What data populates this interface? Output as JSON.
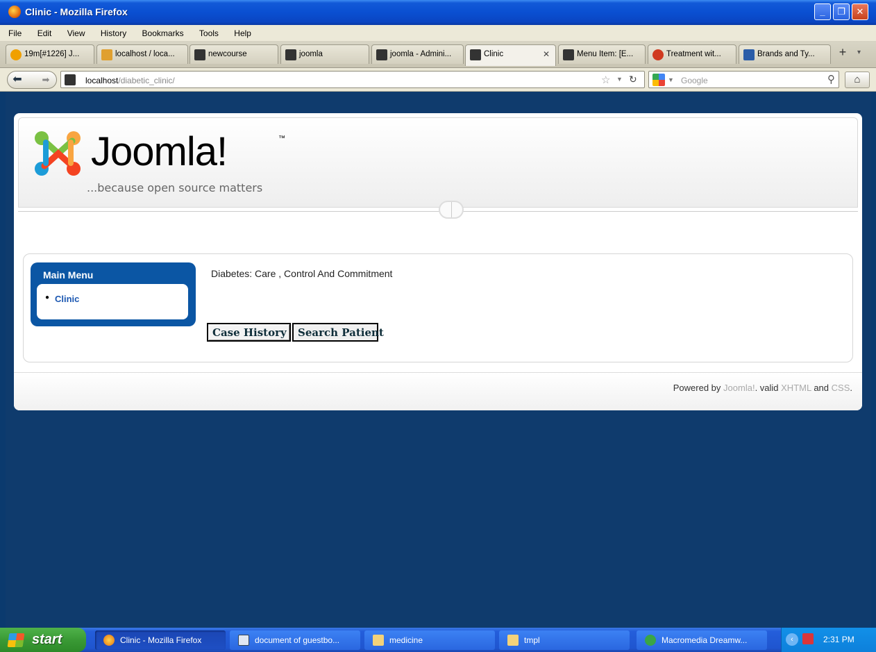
{
  "window": {
    "title": "Clinic - Mozilla Firefox",
    "controls": [
      "minimize",
      "maximize",
      "close"
    ]
  },
  "menubar": {
    "items": [
      "File",
      "Edit",
      "View",
      "History",
      "Bookmarks",
      "Tools",
      "Help"
    ]
  },
  "tabs": [
    {
      "label": "19m[#1226] J...",
      "icon": "clock-icon",
      "color": "#f0a000"
    },
    {
      "label": "localhost / loca...",
      "icon": "phpmyadmin-icon",
      "color": "#e0a030"
    },
    {
      "label": "newcourse",
      "icon": "joomla-icon",
      "color": "#333333"
    },
    {
      "label": "joomla",
      "icon": "joomla-icon",
      "color": "#333333"
    },
    {
      "label": "joomla - Admini...",
      "icon": "joomla-icon",
      "color": "#333333"
    },
    {
      "label": "Clinic",
      "icon": "joomla-icon",
      "color": "#333333",
      "active": true
    },
    {
      "label": "Menu Item: [E...",
      "icon": "joomla-icon",
      "color": "#333333"
    },
    {
      "label": "Treatment wit...",
      "icon": "heart-icon",
      "color": "#d03a20"
    },
    {
      "label": "Brands and Ty...",
      "icon": "webmd-icon",
      "color": "#2a5ca8"
    }
  ],
  "navbar": {
    "url_host": "localhost",
    "url_path": "/diabetic_clinic/",
    "search_placeholder": "Google"
  },
  "site": {
    "logo_word": "Joomla!",
    "logo_tm": "™",
    "slogan": "...because open source matters",
    "main_menu_title": "Main Menu",
    "main_menu_items": [
      "Clinic"
    ],
    "intro_text": "Diabetes: Care , Control And Commitment",
    "buttons": {
      "case_history": "Case History",
      "search_patient": "Search Patient"
    },
    "footer": {
      "prefix": "Powered by ",
      "joomla": "Joomla!",
      "mid": ". valid ",
      "xhtml": "XHTML",
      "and": " and ",
      "css": "CSS",
      "suffix": "."
    }
  },
  "taskbar": {
    "start": "start",
    "tasks": [
      {
        "label": "Clinic - Mozilla Firefox",
        "icon": "firefox-icon",
        "active": true
      },
      {
        "label": "document of guestbo...",
        "icon": "word-document-icon"
      },
      {
        "label": "medicine",
        "icon": "folder-icon"
      },
      {
        "label": "tmpl",
        "icon": "folder-icon"
      },
      {
        "label": "Macromedia Dreamw...",
        "icon": "dreamweaver-icon"
      }
    ],
    "clock": "2:31 PM"
  },
  "colors": {
    "page_background": "#0f3b6d",
    "menu_blue": "#0b56a4",
    "link_blue": "#1b57b1"
  }
}
